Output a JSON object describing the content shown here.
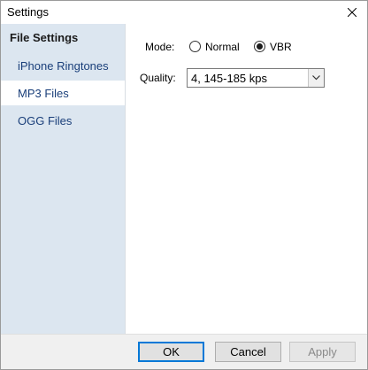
{
  "window": {
    "title": "Settings"
  },
  "sidebar": {
    "header": "File Settings",
    "items": [
      {
        "label": "iPhone Ringtones",
        "active": false
      },
      {
        "label": "MP3 Files",
        "active": true
      },
      {
        "label": "OGG Files",
        "active": false
      }
    ]
  },
  "mp3": {
    "mode_label": "Mode:",
    "mode_options": [
      {
        "label": "Normal",
        "checked": false
      },
      {
        "label": "VBR",
        "checked": true
      }
    ],
    "quality_label": "Quality:",
    "quality_value": "4,  145-185 kps"
  },
  "footer": {
    "ok_label": "OK",
    "cancel_label": "Cancel",
    "apply_label": "Apply"
  },
  "icons": [
    "close-icon",
    "chevron-down-icon"
  ]
}
